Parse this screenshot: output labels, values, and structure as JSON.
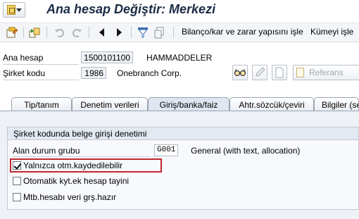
{
  "title": "Ana hesap Değiştir: Merkezi",
  "toolbar": {
    "icons": [
      "display-change-icon",
      "other-object-icon",
      "undo-icon",
      "redo-icon",
      "previous-icon",
      "next-icon",
      "filter-icon",
      "copy-icon"
    ],
    "buttons": [
      "Bilanço/kar ve zarar yapısını işle",
      "Kümeyi işle"
    ]
  },
  "header": {
    "account_label": "Ana hesap",
    "account_value": "1500101100",
    "account_text": "HAMMADDELER",
    "company_label": "Şirket kodu",
    "company_value": "1986",
    "company_text": "Onebranch Corp.",
    "reference_label": "Referans"
  },
  "tabs": [
    {
      "label": "Tip/tanım",
      "active": false
    },
    {
      "label": "Denetim verileri",
      "active": false
    },
    {
      "label": "Giriş/banka/faiz",
      "active": true
    },
    {
      "label": "Ahtr.sözcük/çeviri",
      "active": false
    },
    {
      "label": "Bilgiler (se",
      "active": false
    }
  ],
  "group": {
    "title": "Şirket kodunda belge girişi denetimi",
    "field_status_label": "Alan durum grubu",
    "field_status_value": "G001",
    "field_status_text": "General (with text, allocation)",
    "checkboxes": [
      {
        "label": "Yalnızca otm.kaydedilebilir",
        "checked": true
      },
      {
        "label": "Otomatik kyt.ek hesap tayini",
        "checked": false
      },
      {
        "label": "Mtb.hesabı veri grş.hazır",
        "checked": false
      }
    ]
  },
  "colors": {
    "highlight": "#c0282e",
    "title": "#1b2b45"
  }
}
